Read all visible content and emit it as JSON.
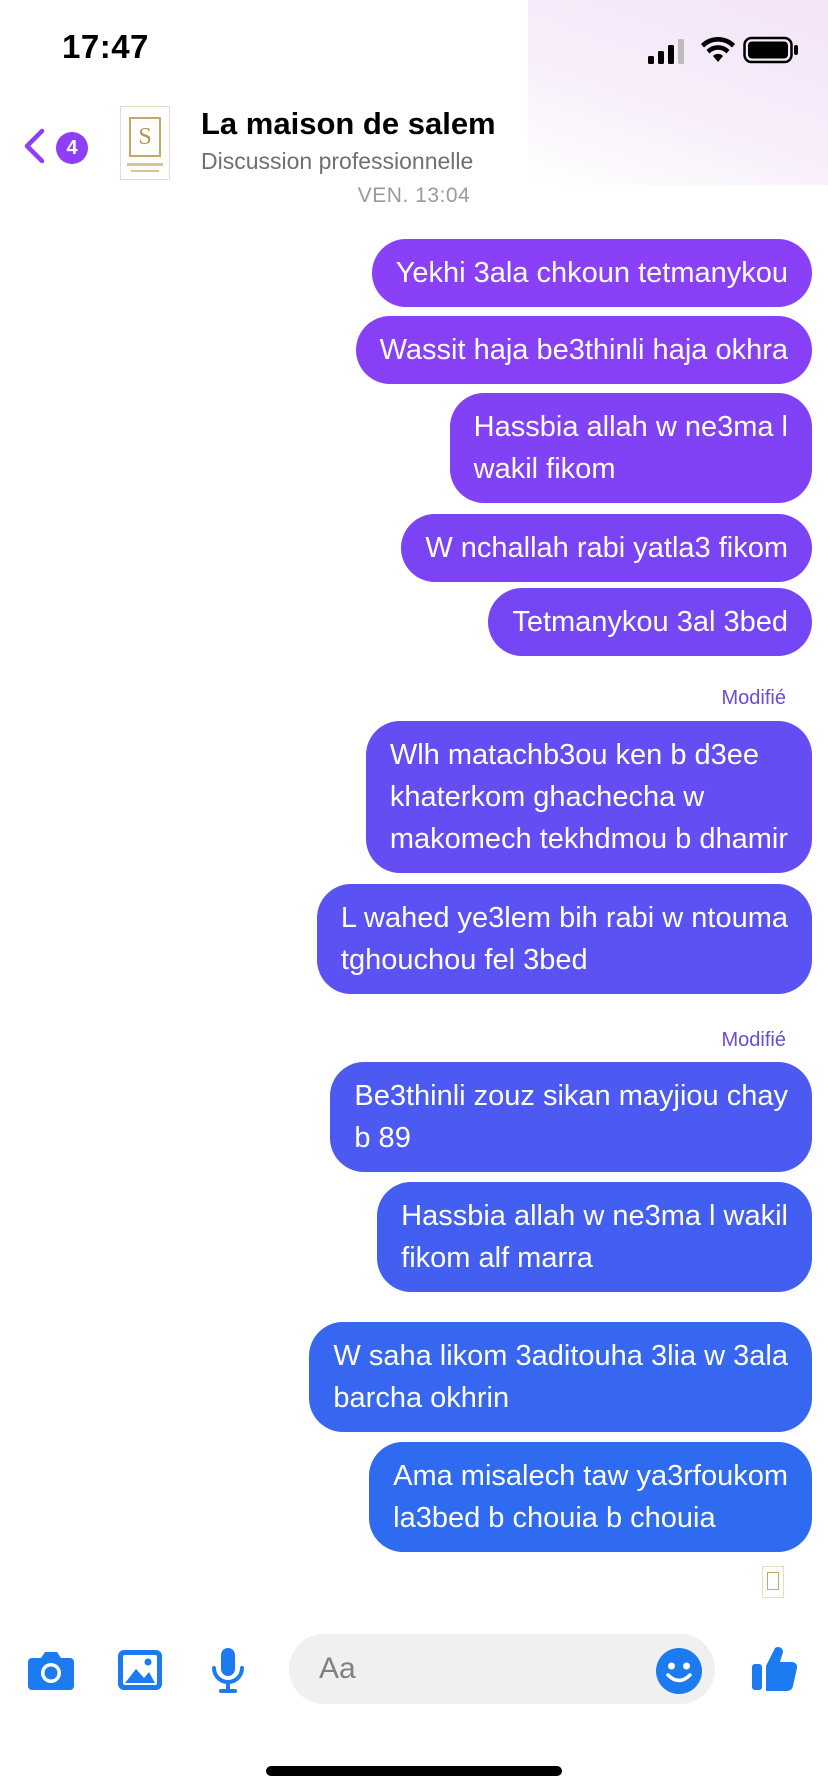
{
  "status_bar": {
    "time": "17:47"
  },
  "header": {
    "back_badge": "4",
    "contact_name": "La maison de salem",
    "subtitle": "Discussion professionnelle",
    "avatar_letter": "S"
  },
  "conversation": {
    "timestamp": "VEN. 13:04",
    "messages": [
      {
        "text": "Yekhi 3ala chkoun tetmanykou",
        "color": "#8a40f6"
      },
      {
        "text": "Wassit haja be3thinli haja okhra",
        "color": "#8740f6"
      },
      {
        "lines": [
          "Hassbia allah w ne3ma l",
          "wakil fikom"
        ],
        "color": "#8141f5"
      },
      {
        "text": "W nchallah rabi yatla3 fikom",
        "color": "#7a43f4"
      },
      {
        "text": "Tetmanykou 3al 3bed",
        "color": "#7446f4"
      },
      {
        "edited": "Modifié"
      },
      {
        "lines": [
          "Wlh matachb3ou ken b d3ee",
          "khaterkom ghachecha w",
          "makomech tekhdmou b dhamir"
        ],
        "color": "#634df3"
      },
      {
        "lines": [
          "L wahed ye3lem bih rabi w ntouma",
          "tghouchou fel 3bed"
        ],
        "color": "#5a52f2"
      },
      {
        "edited": "Modifié"
      },
      {
        "lines": [
          "Be3thinli zouz sikan mayjiou chay",
          "b 89"
        ],
        "color": "#4c5af1"
      },
      {
        "lines": [
          "Hassbia allah w ne3ma l wakil",
          "fikom alf marra"
        ],
        "color": "#425ff1"
      },
      {
        "lines": [
          "W saha likom 3aditouha 3lia w 3ala",
          "barcha okhrin"
        ],
        "color": "#3766f0"
      },
      {
        "lines": [
          "Ama misalech taw ya3rfoukom",
          "la3bed b chouia b chouia"
        ],
        "color": "#2e6bf0"
      }
    ]
  },
  "composer": {
    "placeholder": "Aa",
    "icons": [
      "camera-icon",
      "gallery-icon",
      "microphone-icon",
      "emoji-icon",
      "thumbs-up-icon"
    ],
    "accent_color": "#1d7bf2"
  },
  "colors": {
    "purple": "#8e3ef7",
    "blue": "#2e6bf0",
    "edited_label": "#6b4bd9"
  }
}
